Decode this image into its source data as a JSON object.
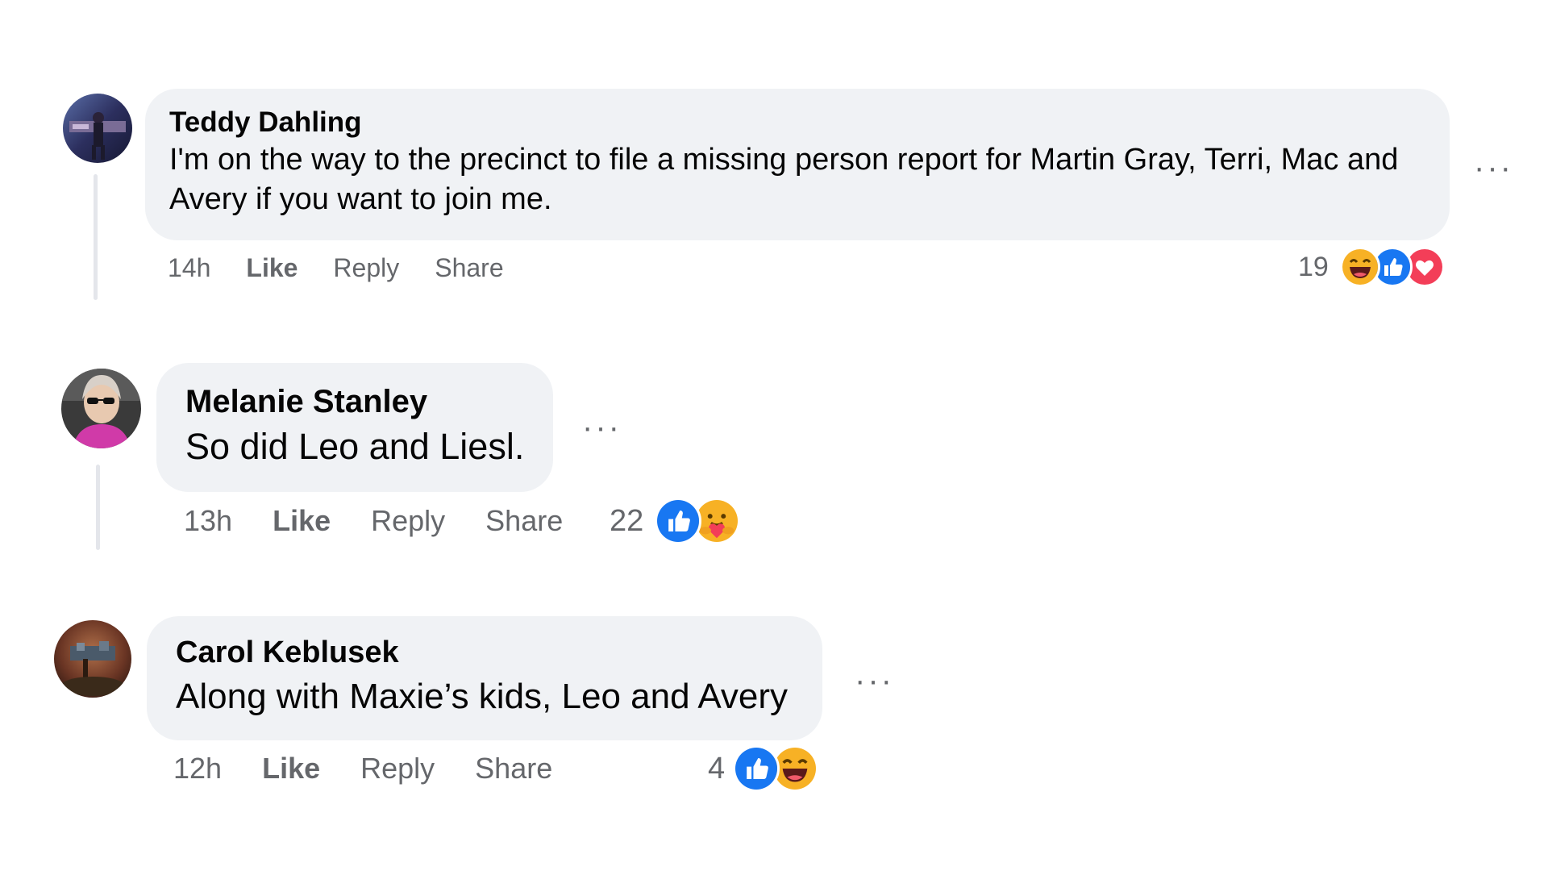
{
  "comments": [
    {
      "author": "Teddy Dahling",
      "text": "I'm on the way to the precinct to file a missing person report for Martin Gray, Terri, Mac and Avery if you want to join me.",
      "time": "14h",
      "like_label": "Like",
      "reply_label": "Reply",
      "share_label": "Share",
      "reaction_count": "19",
      "reactions": [
        "haha",
        "like",
        "love"
      ],
      "more_label": "···"
    },
    {
      "author": "Melanie Stanley",
      "text": "So did Leo and Liesl.",
      "time": "13h",
      "like_label": "Like",
      "reply_label": "Reply",
      "share_label": "Share",
      "reaction_count": "22",
      "reactions": [
        "like",
        "care"
      ],
      "more_label": "···"
    },
    {
      "author": "Carol Keblusek",
      "text": "Along with Maxie’s kids, Leo and Avery",
      "time": "12h",
      "like_label": "Like",
      "reply_label": "Reply",
      "share_label": "Share",
      "reaction_count": "4",
      "reactions": [
        "like",
        "haha"
      ],
      "more_label": "···"
    }
  ],
  "colors": {
    "bubble": "#f0f2f5",
    "secondary_text": "#65676b",
    "like_blue": "#1877f2",
    "love_red": "#f33e58",
    "emoji_yellow": "#f7b125"
  }
}
